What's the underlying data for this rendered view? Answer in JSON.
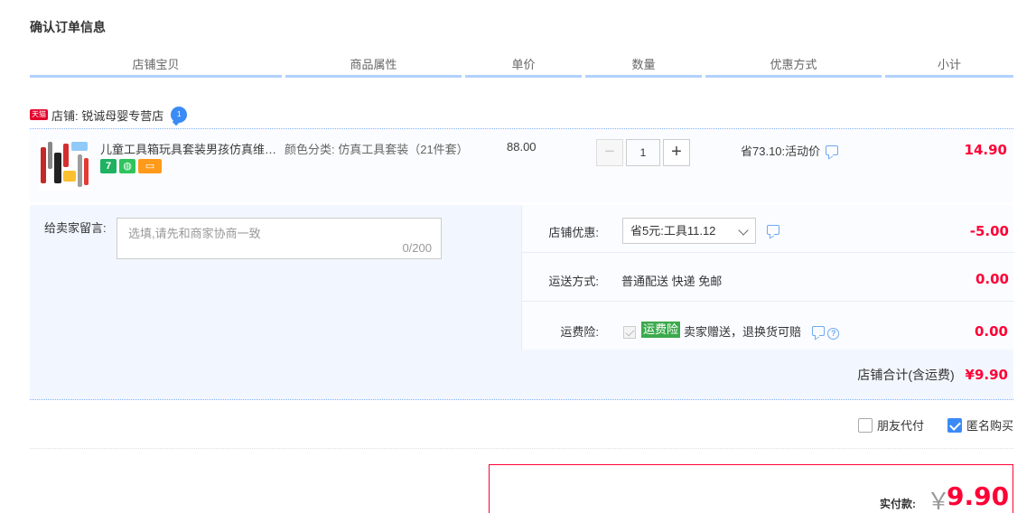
{
  "page": {
    "title": "确认订单信息"
  },
  "columns": [
    "店铺宝贝",
    "商品属性",
    "单价",
    "数量",
    "优惠方式",
    "小计"
  ],
  "shop": {
    "badge": "天猫",
    "label": "店铺: 锐诚母婴专营店",
    "chat_badge": "1"
  },
  "item": {
    "title": "儿童工具箱玩具套装男孩仿真维修...",
    "service_icons": [
      "7",
      "",
      ""
    ],
    "attribute": "颜色分类: 仿真工具套装（21件套）",
    "price": "88.00",
    "quantity": "1",
    "minus": "−",
    "plus": "+",
    "promotion": "省73.10:活动价",
    "subtotal": "14.90"
  },
  "memo": {
    "label": "给卖家留言:",
    "placeholder": "选填,请先和商家协商一致",
    "count": "0/200"
  },
  "shop_coupon": {
    "label": "店铺优惠:",
    "selected": "省5元:工具11.12",
    "value": "-5.00"
  },
  "shipping": {
    "label": "运送方式:",
    "method": "普通配送 快递 免邮",
    "value": "0.00"
  },
  "insurance": {
    "label": "运费险:",
    "badge": "运费险",
    "text": "卖家赠送，退换货可赔",
    "help": "?",
    "value": "0.00"
  },
  "shop_total": {
    "label": "店铺合计(含运费)",
    "value": "¥9.90"
  },
  "options": {
    "friend_pay": "朋友代付",
    "friend_pay_checked": false,
    "anonymous": "匿名购买",
    "anonymous_checked": true
  },
  "payment": {
    "label": "实付款:",
    "currency": "￥",
    "amount": "9.90"
  },
  "colors": {
    "accent_red": "#ff0036",
    "header_line": "#b2d1ff",
    "panel_bg": "#f2f7ff",
    "checkbox_blue": "#3b8bf6",
    "insurance_green": "#3ba94c"
  }
}
